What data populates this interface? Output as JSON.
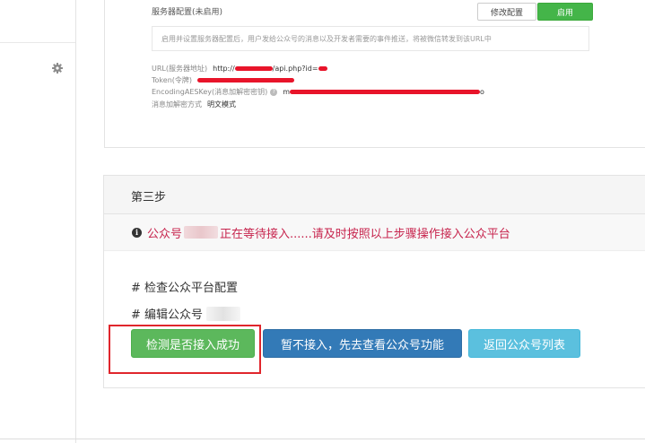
{
  "server_config": {
    "title": "服务器配置(未启用)",
    "modify_label": "修改配置",
    "enable_label": "启用",
    "notice": "启用并设置服务器配置后，用户发给公众号的消息以及开发者需要的事件推送，将被微信转发到该URL中",
    "url_label": "URL(服务器地址)",
    "url_prefix": "http://",
    "url_mid": "/api.php?id=",
    "token_label": "Token(令牌)",
    "aes_label": "EncodingAESKey(消息加解密密钥)",
    "aes_prefix": "m",
    "aes_suffix": "o",
    "mode_label": "消息加解密方式",
    "mode_value": "明文模式"
  },
  "step": {
    "title": "第三步",
    "alert_prefix": "公众号",
    "alert_suffix": "正在等待接入......请及时按照以上步骤操作接入公众平台",
    "check_item": "# 检查公众平台配置",
    "edit_item": "# 编辑公众号"
  },
  "buttons": {
    "check": "检测是否接入成功",
    "later": "暂不接入，先去查看公众号功能",
    "back": "返回公众号列表"
  },
  "colors": {
    "green": "#5cb85c",
    "blue": "#337ab7",
    "light_blue": "#5bc0de",
    "alert_red": "#c7254e",
    "highlight": "#e0262c"
  }
}
